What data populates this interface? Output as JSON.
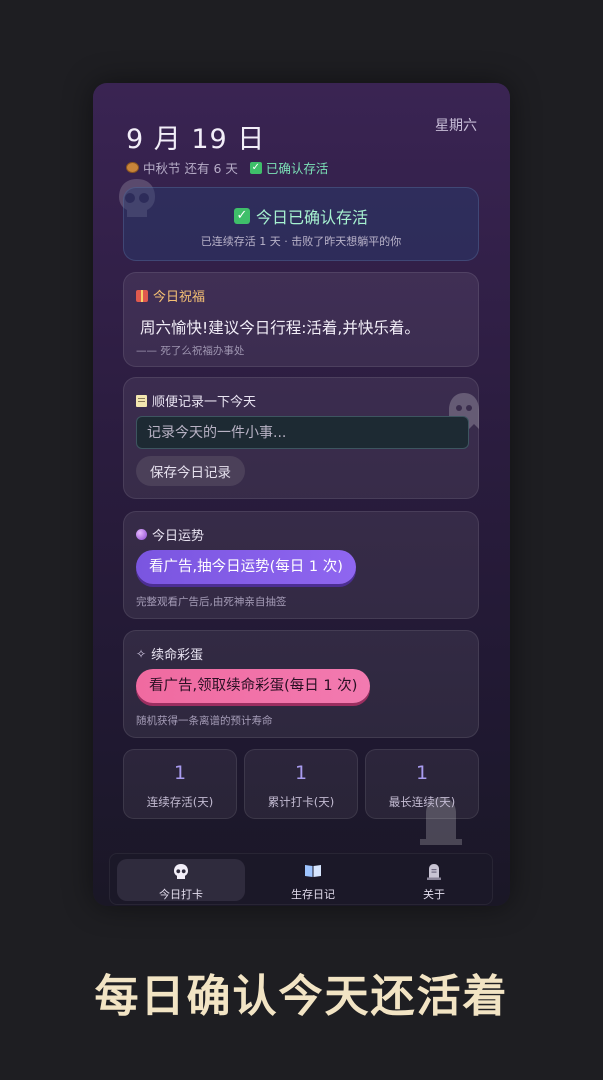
{
  "header": {
    "date": "9 月 19 日",
    "weekday": "星期六",
    "festival": "中秋节 还有 6 天",
    "status": "已确认存活"
  },
  "confirm_card": {
    "title": "今日已确认存活",
    "subtitle": "已连续存活 1 天 · 击败了昨天想躺平的你"
  },
  "blessing_card": {
    "heading": "今日祝福",
    "text": "周六愉快!建议今日行程:活着,并快乐着。",
    "footer": "—— 死了么祝福办事处"
  },
  "note_card": {
    "heading": "顺便记录一下今天",
    "placeholder": "记录今天的一件小事...",
    "save_label": "保存今日记录"
  },
  "fortune_card": {
    "heading": "今日运势",
    "button_label": "看广告,抽今日运势(每日 1 次)",
    "footer": "完整观看广告后,由死神亲自抽签"
  },
  "egg_card": {
    "heading": "续命彩蛋",
    "button_label": "看广告,领取续命彩蛋(每日 1 次)",
    "footer": "随机获得一条离谱的预计寿命"
  },
  "stats": [
    {
      "value": "1",
      "label": "连续存活(天)"
    },
    {
      "value": "1",
      "label": "累计打卡(天)"
    },
    {
      "value": "1",
      "label": "最长连续(天)"
    }
  ],
  "tabs": [
    {
      "label": "今日打卡",
      "icon": "skull-icon",
      "active": true
    },
    {
      "label": "生存日记",
      "icon": "book-icon",
      "active": false
    },
    {
      "label": "关于",
      "icon": "tombstone-icon",
      "active": false
    }
  ],
  "slogan": "每日确认今天还活着",
  "colors": {
    "accent_purple": "#8f66f0",
    "accent_pink": "#f27ab0",
    "status_green": "#7be0b6",
    "blessing_gold": "#f5c074"
  }
}
